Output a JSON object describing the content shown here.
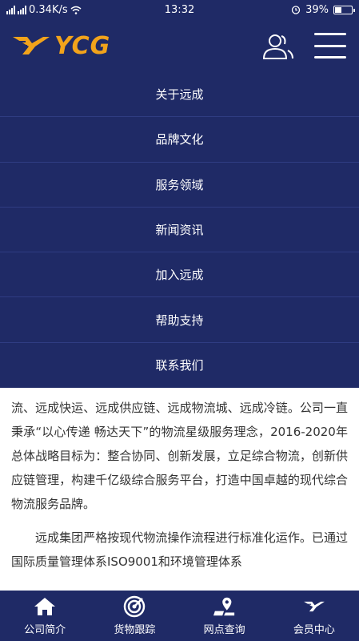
{
  "status_bar": {
    "network_speed": "0.34K/s",
    "time": "13:32",
    "battery": "39%",
    "battery_level": 0.39
  },
  "header": {
    "logo_text": "YCG",
    "brand_color": "#f2a31b",
    "background_color": "#1f2a66"
  },
  "nav_menu": {
    "items": [
      {
        "label": "关于远成"
      },
      {
        "label": "品牌文化"
      },
      {
        "label": "服务领域"
      },
      {
        "label": "新闻资讯"
      },
      {
        "label": "加入远成"
      },
      {
        "label": "帮助支持"
      },
      {
        "label": "联系我们"
      }
    ]
  },
  "content": {
    "paragraph_1": "流、远成快运、远成供应链、远成物流城、远成冷链。公司一直秉承“以心传递 畅达天下”的物流星级服务理念，2016-2020年总体战略目标为：整合协同、创新发展，立足综合物流，创新供应链管理，构建千亿级综合服务平台，打造中国卓越的现代综合物流服务品牌。",
    "paragraph_2": "远成集团严格按现代物流操作流程进行标准化运作。已通过国际质量管理体系ISO9001和环境管理体系"
  },
  "tab_bar": {
    "tabs": [
      {
        "label": "公司简介",
        "icon": "home-icon"
      },
      {
        "label": "货物跟踪",
        "icon": "tracking-icon"
      },
      {
        "label": "网点查询",
        "icon": "location-icon"
      },
      {
        "label": "会员中心",
        "icon": "member-logo-icon"
      }
    ]
  }
}
